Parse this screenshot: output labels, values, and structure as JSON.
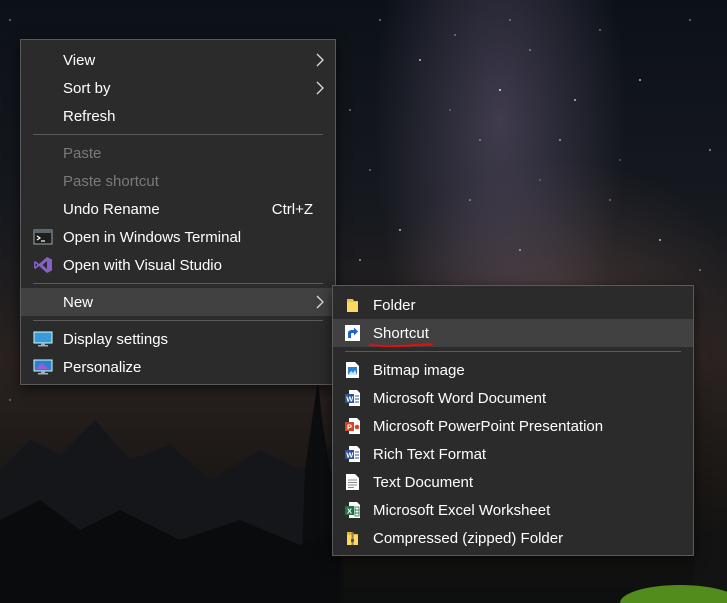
{
  "context_menu": {
    "items": [
      {
        "label": "View"
      },
      {
        "label": "Sort by"
      },
      {
        "label": "Refresh"
      },
      {
        "label": "Paste"
      },
      {
        "label": "Paste shortcut"
      },
      {
        "label": "Undo Rename",
        "shortcut": "Ctrl+Z"
      },
      {
        "label": "Open in Windows Terminal"
      },
      {
        "label": "Open with Visual Studio"
      },
      {
        "label": "New"
      },
      {
        "label": "Display settings"
      },
      {
        "label": "Personalize"
      }
    ]
  },
  "new_submenu": {
    "items": [
      {
        "label": "Folder"
      },
      {
        "label": "Shortcut"
      },
      {
        "label": "Bitmap image"
      },
      {
        "label": "Microsoft Word Document"
      },
      {
        "label": "Microsoft PowerPoint Presentation"
      },
      {
        "label": "Rich Text Format"
      },
      {
        "label": "Text Document"
      },
      {
        "label": "Microsoft Excel Worksheet"
      },
      {
        "label": "Compressed (zipped) Folder"
      }
    ]
  },
  "colors": {
    "menu_bg": "#2b2b2b",
    "highlight": "#414141",
    "disabled_text": "#7a7a7a",
    "annotation_underline": "#e01010"
  }
}
